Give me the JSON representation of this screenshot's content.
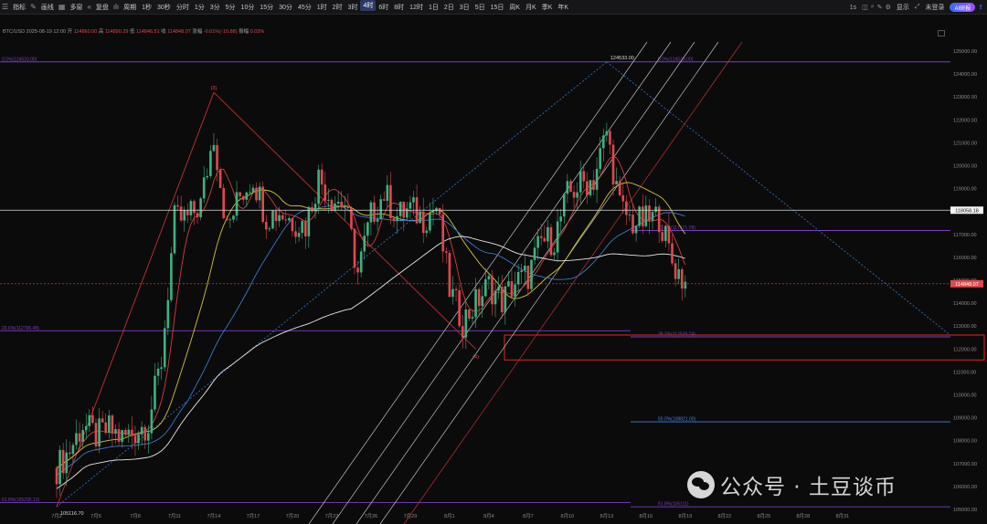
{
  "toolbar": {
    "left_items": [
      "指标",
      "画线",
      "多窗",
      "复盘"
    ],
    "period_label": "周期",
    "intervals": [
      "1秒",
      "30秒",
      "分时",
      "1分",
      "3分",
      "5分",
      "10分",
      "15分",
      "30分",
      "45分",
      "1时",
      "2时",
      "3时",
      "4时",
      "6时",
      "8时",
      "12时",
      "1日",
      "2日",
      "3日",
      "5日",
      "15日",
      "周K",
      "月K",
      "季K",
      "年K"
    ],
    "active_interval": "4时",
    "right_items": [
      "1s",
      "显示",
      "未登录"
    ],
    "badge": "AI研报"
  },
  "info": {
    "symbol": "BTC/USD",
    "datetime": "2025-08-19 12:00",
    "open_label": "开",
    "open": "114860.00",
    "high_label": "高",
    "high": "114890.29",
    "low_label": "低",
    "low": "114846.51",
    "close_label": "收",
    "close": "114848.07",
    "change_label": "涨幅",
    "change": "-0.01%(-10.88)",
    "amp_label": "振幅",
    "amp": "0.03%"
  },
  "price_tags": {
    "horizontal_line": "118058.18",
    "last": "114848.07"
  },
  "watermark": "公众号 · 土豆谈币",
  "colors": {
    "bg": "#0b0b0c",
    "up": "#3fb27f",
    "down": "#e0484f",
    "ma_red": "#d43c3c",
    "ma_yellow": "#d6c43a",
    "ma_blue": "#3a78c8",
    "ma_white": "#e8e8e8",
    "fib_purple": "#7a3fbf",
    "fib_blue": "#4a7fd8",
    "highlight": "#e02626"
  },
  "chart_data": {
    "type": "candlestick",
    "x_ticks": [
      "7月2",
      "7月5",
      "7月8",
      "7月11",
      "7月14",
      "7月17",
      "7月20",
      "7月23",
      "7月26",
      "7月29",
      "8月1",
      "8月4",
      "8月7",
      "8月10",
      "8月13",
      "8月16",
      "8月19",
      "8月22",
      "8月25",
      "8月28",
      "8月31"
    ],
    "y_ticks": [
      105000,
      106000,
      107000,
      108000,
      109000,
      110000,
      111000,
      112000,
      113000,
      114000,
      115000,
      116000,
      117000,
      118000,
      119000,
      120000,
      121000,
      122000,
      123000,
      124000,
      125000
    ],
    "y_range": [
      104600,
      125400
    ],
    "path": [
      [
        "7月2",
        106800
      ],
      [
        "7月3",
        107600
      ],
      [
        "7月4",
        108700
      ],
      [
        "7月5",
        108200
      ],
      [
        "7月6",
        108500
      ],
      [
        "7月7",
        108100
      ],
      [
        "7月8",
        108400
      ],
      [
        "7月9",
        108800
      ],
      [
        "7月10",
        111500
      ],
      [
        "7月11",
        117600
      ],
      [
        "7月12",
        117700
      ],
      [
        "7月13",
        118300
      ],
      [
        "7月14",
        121400
      ],
      [
        "7月15",
        117200
      ],
      [
        "7月16",
        118700
      ],
      [
        "7月17",
        119500
      ],
      [
        "7月18",
        117800
      ],
      [
        "7月19",
        118000
      ],
      [
        "7月20",
        117600
      ],
      [
        "7月21",
        117400
      ],
      [
        "7月22",
        119500
      ],
      [
        "7月23",
        118600
      ],
      [
        "7月24",
        118300
      ],
      [
        "7月25",
        115300
      ],
      [
        "7月26",
        117800
      ],
      [
        "7月27",
        118800
      ],
      [
        "7月28",
        117800
      ],
      [
        "7月29",
        118100
      ],
      [
        "7月30",
        117700
      ],
      [
        "7月31",
        118200
      ],
      [
        "8月1",
        114600
      ],
      [
        "8月2",
        113200
      ],
      [
        "8月3",
        114000
      ],
      [
        "8月4",
        114800
      ],
      [
        "8月5",
        114100
      ],
      [
        "8月6",
        114900
      ],
      [
        "8月7",
        115200
      ],
      [
        "8月8",
        116700
      ],
      [
        "8月9",
        116800
      ],
      [
        "8月10",
        118700
      ],
      [
        "8月11",
        119200
      ],
      [
        "8月12",
        119400
      ],
      [
        "8月13",
        121500
      ],
      [
        "8月14",
        118200
      ],
      [
        "8月15",
        117500
      ],
      [
        "8月16",
        117600
      ],
      [
        "8月17",
        117800
      ],
      [
        "8月18",
        115800
      ],
      [
        "8月19",
        114848
      ]
    ],
    "extremes": [
      {
        "date": "7月14",
        "high": 123200
      },
      {
        "date": "8月13",
        "high": 124530
      },
      {
        "date": "7月2",
        "low": 105116.7
      },
      {
        "date": "8月3",
        "low": 112000
      }
    ],
    "horizontal_line": 118058.18,
    "last_price": 114848.07,
    "fib_levels": [
      {
        "label": "0.0%(124533.00)",
        "value": 124533.0
      },
      {
        "label": "23.6%(117171.78)",
        "value": 117171.78
      },
      {
        "label": "38.2%(112529.74)",
        "value": 112529.74
      },
      {
        "label": "50.0%(108821.00)",
        "value": 108821.0
      },
      {
        "label": "61.8%(105111)",
        "value": 105111.0
      }
    ],
    "left_fib_levels": [
      {
        "label": "0.0%(124533.00)",
        "value": 124533.0
      },
      {
        "label": "23.6%(112796.48)",
        "value": 112796.48
      },
      {
        "label": "61.8%(105295.13)",
        "value": 105295.13
      }
    ],
    "marks": [
      {
        "text": "(3)",
        "date": "7月14",
        "value": 123200
      },
      {
        "text": "(4)",
        "date": "8月3",
        "value": 112000
      },
      {
        "text": "124533.00",
        "date": "8月13",
        "value": 124533
      },
      {
        "text": "105116.70",
        "date": "7月2",
        "value": 105116.7
      }
    ],
    "grid": false
  }
}
